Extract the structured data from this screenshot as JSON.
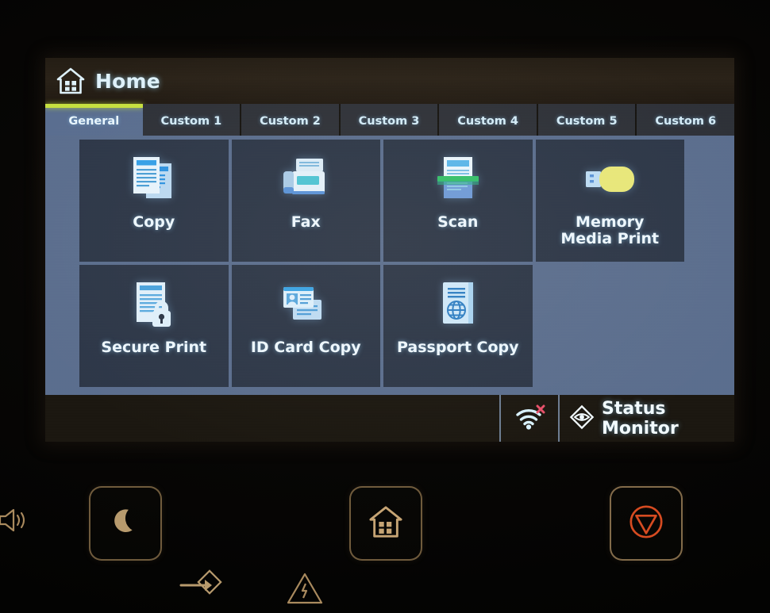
{
  "header": {
    "title": "Home",
    "icon": "home-icon"
  },
  "tabs": [
    {
      "label": "General",
      "active": true
    },
    {
      "label": "Custom 1",
      "active": false
    },
    {
      "label": "Custom 2",
      "active": false
    },
    {
      "label": "Custom 3",
      "active": false
    },
    {
      "label": "Custom 4",
      "active": false
    },
    {
      "label": "Custom 5",
      "active": false
    },
    {
      "label": "Custom 6",
      "active": false
    }
  ],
  "tiles": [
    {
      "label": "Copy",
      "icon": "copy-documents-icon"
    },
    {
      "label": "Fax",
      "icon": "fax-machine-icon"
    },
    {
      "label": "Scan",
      "icon": "scanner-document-icon"
    },
    {
      "label": "Memory\nMedia Print",
      "icon": "usb-flash-drive-icon"
    },
    {
      "label": "Secure Print",
      "icon": "document-lock-icon"
    },
    {
      "label": "ID Card Copy",
      "icon": "id-cards-icon"
    },
    {
      "label": "Passport Copy",
      "icon": "passport-globe-icon"
    }
  ],
  "statusbar": {
    "wifi_icon": "wifi-disconnected-icon",
    "status_monitor_icon": "eye-diamond-icon",
    "status_monitor_label": "Status Monitor"
  },
  "hardware": {
    "volume_icon": "speaker-volume-icon",
    "sleep_icon": "crescent-moon-icon",
    "home_key_icon": "home-house-icon",
    "stop_icon": "stop-circle-triangle-icon",
    "data_icon": "arrow-into-diamond-icon",
    "error_icon": "warning-triangle-icon"
  },
  "colors": {
    "accent_tab": "#c6e03f",
    "content_bg": "#5b6e8e",
    "tile_bg": "#2d3748",
    "tab_active_bg": "#5a6e90",
    "tab_bg": "#2e3138",
    "text": "#eef8ff",
    "usb_body": "#e9e87a",
    "scan_bar": "#35c06a",
    "stop_red": "#d64b21",
    "key_outline": "#c4a06c",
    "wifi_x": "#e8506a"
  }
}
